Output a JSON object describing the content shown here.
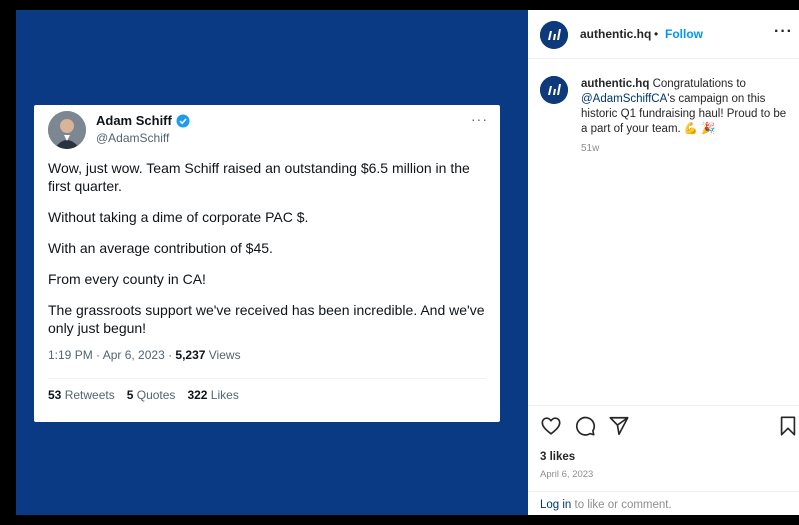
{
  "tweet": {
    "name": "Adam Schiff",
    "handle": "@AdamSchiff",
    "more": "···",
    "paragraphs": [
      "Wow, just wow. Team Schiff raised an outstanding $6.5 million in the first quarter.",
      "Without taking a dime of corporate PAC $.",
      "With an average contribution of $45.",
      "From every county in CA!",
      "The grassroots support we've received has been incredible. And we've only just begun!"
    ],
    "meta_prefix": "1:19 PM · Apr 6, 2023 · ",
    "views_count": "5,237",
    "views_label": " Views",
    "retweets_count": "53",
    "retweets_label": " Retweets",
    "quotes_count": "5",
    "quotes_label": " Quotes",
    "likes_count": "322",
    "likes_label": " Likes"
  },
  "post": {
    "username": "authentic.hq",
    "dot": "•",
    "follow_label": "Follow",
    "more": "···",
    "caption_user": "authentic.hq",
    "caption_pre": " Congratulations to ",
    "caption_mention": "@AdamSchiffCA",
    "caption_post": "'s campaign on this historic Q1 fundraising haul! Proud to be a part of your team. 💪 🎉",
    "caption_time": "51w",
    "likes": "3 likes",
    "date": "April 6, 2023",
    "login_link": "Log in",
    "login_rest": " to like or comment."
  },
  "icons": {
    "like": "heart-icon",
    "comment": "comment-icon",
    "share": "paper-plane-icon",
    "save": "bookmark-icon",
    "verified": "verified-badge-icon",
    "logo": "authentic-logo-icon"
  },
  "colors": {
    "media_background": "#0a3a83",
    "follow": "#0095f6",
    "verified": "#1d9bf0",
    "brand": "#0e3a7c"
  }
}
